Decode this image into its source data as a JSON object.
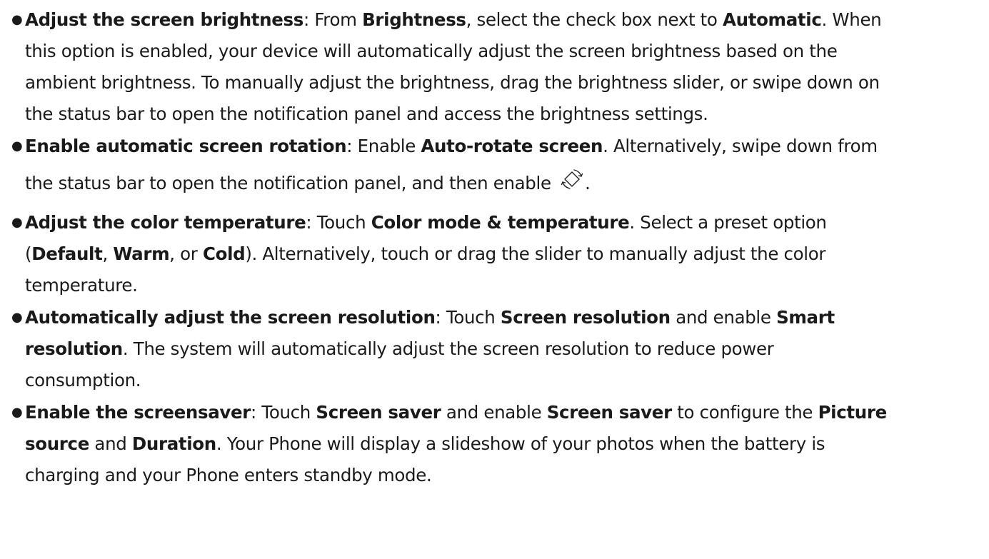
{
  "colors": {
    "text": "#1a1a1a",
    "background": "#ffffff",
    "icon_stroke": "#222222"
  },
  "items": [
    {
      "title": "Adjust the screen brightness",
      "colon": ": ",
      "s1": "From ",
      "b1": "Brightness",
      "s2": ", select the check box next to ",
      "b2": "Automatic",
      "s3": ". When",
      "l2": "this option is enabled, your device will automatically adjust the screen brightness based on the",
      "l3": "ambient brightness. To manually adjust the brightness, drag the brightness slider, or swipe down on",
      "l4": "the status bar to open the notification panel and access the brightness settings."
    },
    {
      "title": "Enable automatic screen rotation",
      "colon": ": ",
      "s1": "Enable ",
      "b1": "Auto-rotate screen",
      "s2": ". Alternatively, swipe down from",
      "l2": "the status bar to open the notification panel, and then enable ",
      "icon": "auto-rotate-icon",
      "l2_end": "."
    },
    {
      "title": "Adjust the color temperature",
      "colon": ": ",
      "s1": "Touch ",
      "b1": "Color mode & temperature",
      "s2": ". Select a preset option",
      "l2_s1": "(",
      "l2_b1": "Default",
      "l2_s2": ", ",
      "l2_b2": "Warm",
      "l2_s3": ", or ",
      "l2_b3": "Cold",
      "l2_s4": "). Alternatively, touch or drag the slider to manually adjust the color",
      "l3": "temperature."
    },
    {
      "title": "Automatically adjust the screen resolution",
      "colon": ": ",
      "s1": "Touch ",
      "b1": "Screen resolution",
      "s2": " and enable ",
      "b2": "Smart",
      "l2_b1": "resolution",
      "l2_s1": ". The system will automatically adjust the screen resolution to reduce power",
      "l3": "consumption."
    },
    {
      "title": "Enable the screensaver",
      "colon": ": ",
      "s1": "Touch ",
      "b1": "Screen saver",
      "s2": " and enable ",
      "b2": "Screen saver",
      "s3": " to configure the ",
      "b3": "Picture",
      "l2_b1": "source",
      "l2_s1": " and ",
      "l2_b2": "Duration",
      "l2_s2": ". Your Phone will display a slideshow of your photos when the battery is",
      "l3": "charging and your Phone enters standby mode."
    }
  ]
}
